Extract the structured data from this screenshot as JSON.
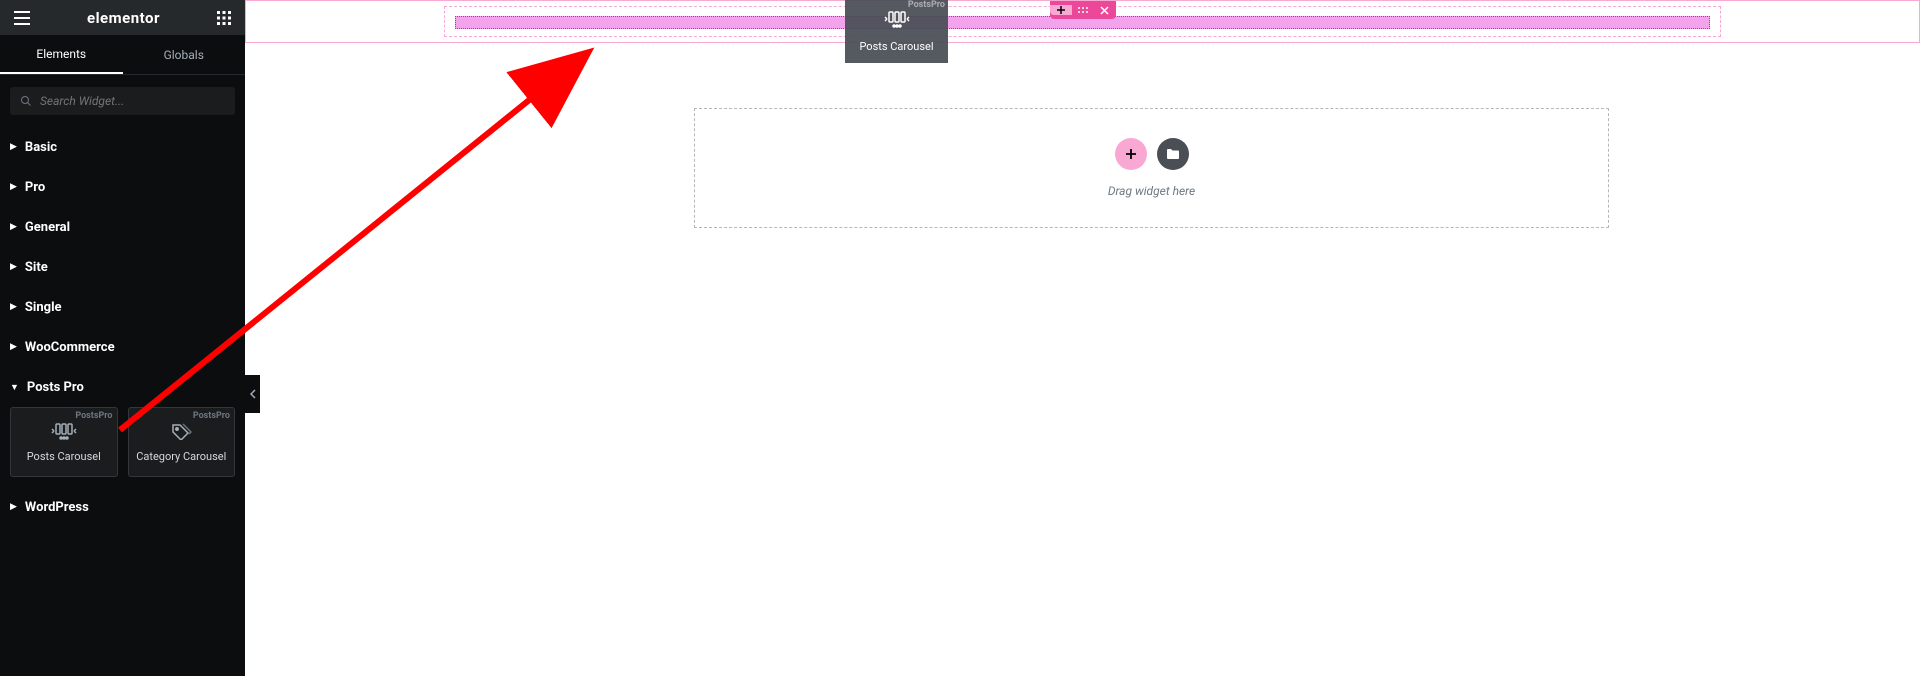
{
  "brand": "elementor",
  "tabs": {
    "elements": "Elements",
    "globals": "Globals"
  },
  "search": {
    "placeholder": "Search Widget..."
  },
  "categories": {
    "basic": "Basic",
    "pro": "Pro",
    "general": "General",
    "site": "Site",
    "single": "Single",
    "woocommerce": "WooCommerce",
    "posts_pro": "Posts Pro",
    "wordpress": "WordPress"
  },
  "widgets": {
    "posts_carousel": {
      "label": "Posts Carousel",
      "badge": "PostsPro"
    },
    "category_carousel": {
      "label": "Category Carousel",
      "badge": "PostsPro"
    }
  },
  "drag_ghost": {
    "label": "Posts Carousel",
    "badge": "PostsPro"
  },
  "dropzone": {
    "text": "Drag widget here"
  }
}
